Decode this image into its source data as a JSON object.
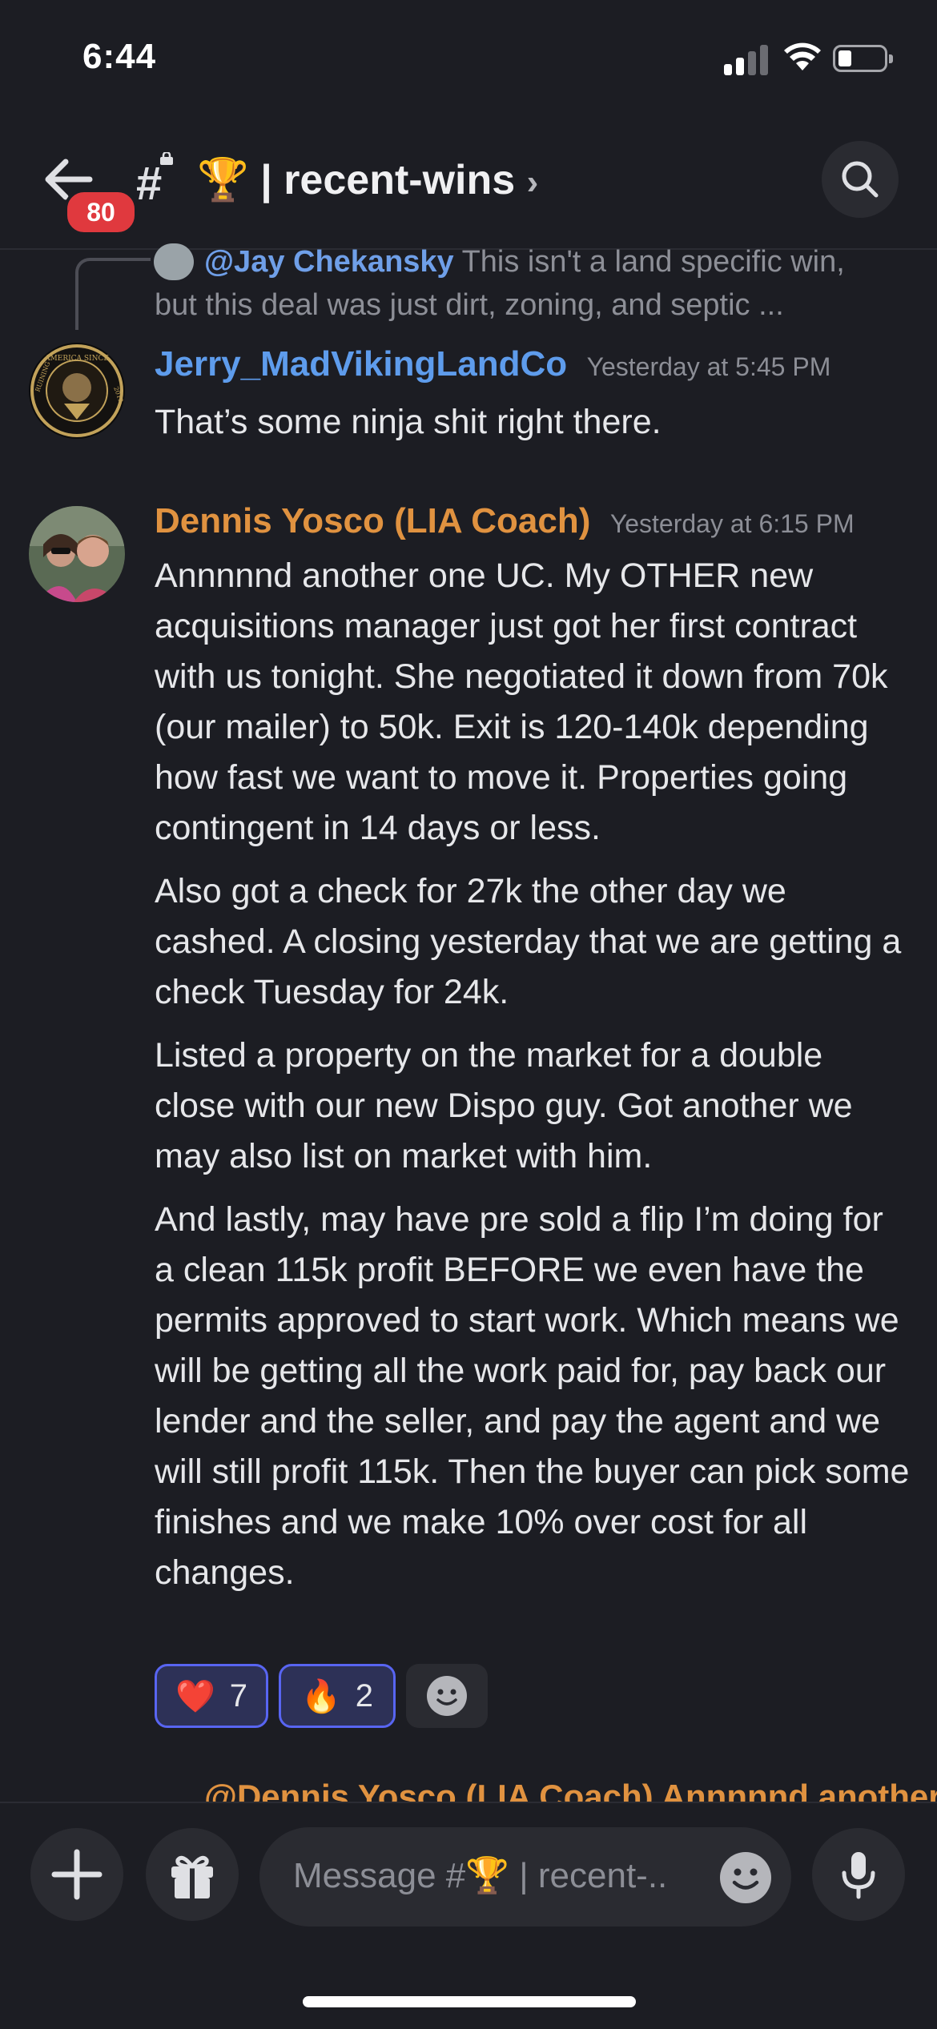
{
  "status_bar": {
    "time": "6:44"
  },
  "header": {
    "unread_count": "80",
    "channel_emoji": "🏆",
    "channel_name": "| recent-wins",
    "chevron": "›"
  },
  "reply_preview": {
    "author": "@Jay Chekansky",
    "text": "This isn't a land specific win,",
    "text_line2": "but this deal was just dirt, zoning, and septic ..."
  },
  "messages": [
    {
      "author": "Jerry_MadVikingLandCo",
      "author_color": "#5e9cec",
      "timestamp": "Yesterday at 5:45 PM",
      "avatar_text_top": "AMERICA SINCE",
      "avatar_text_left": "RUINING",
      "avatar_text_right": "2019",
      "paragraphs": [
        "That’s some ninja shit right there."
      ]
    },
    {
      "author": "Dennis Yosco (LIA Coach)",
      "author_color": "#e09240",
      "timestamp": "Yesterday at 6:15 PM",
      "paragraphs": [
        "Annnnnd another one UC. My OTHER new acquisitions manager just got her first contract with us tonight. She negotiated it down from 70k (our mailer) to 50k. Exit is 120-140k depending how fast we want to move it. Properties going contingent in 14 days or less.",
        "Also got a check for 27k the other day we cashed. A closing yesterday that we are getting a check Tuesday for 24k.",
        "Listed a property on the market for a double close with our new Dispo guy. Got another we may also list on market with him.",
        "And lastly, may have pre sold a flip I’m doing for a clean 115k profit BEFORE we even have the permits approved to start work. Which means we will be getting all the work paid for, pay back our lender and the seller, and pay the agent and we will still profit 115k. Then the buyer can pick some finishes and we make 10% over cost for all changes."
      ],
      "reactions": [
        {
          "emoji": "❤️",
          "count": "7"
        },
        {
          "emoji": "🔥",
          "count": "2"
        }
      ]
    }
  ],
  "next_reply_preview": "@Dennis Yosco (LIA Coach) Annnnnd another",
  "composer": {
    "placeholder": "Message #🏆 | recent-..",
    "icons": [
      "plus-icon",
      "gift-icon",
      "emoji-icon",
      "microphone-icon"
    ]
  },
  "colors": {
    "background": "#1c1d23",
    "mention": "#6f9fe8",
    "badge": "#e0393e",
    "reaction_border": "#5865f2"
  }
}
